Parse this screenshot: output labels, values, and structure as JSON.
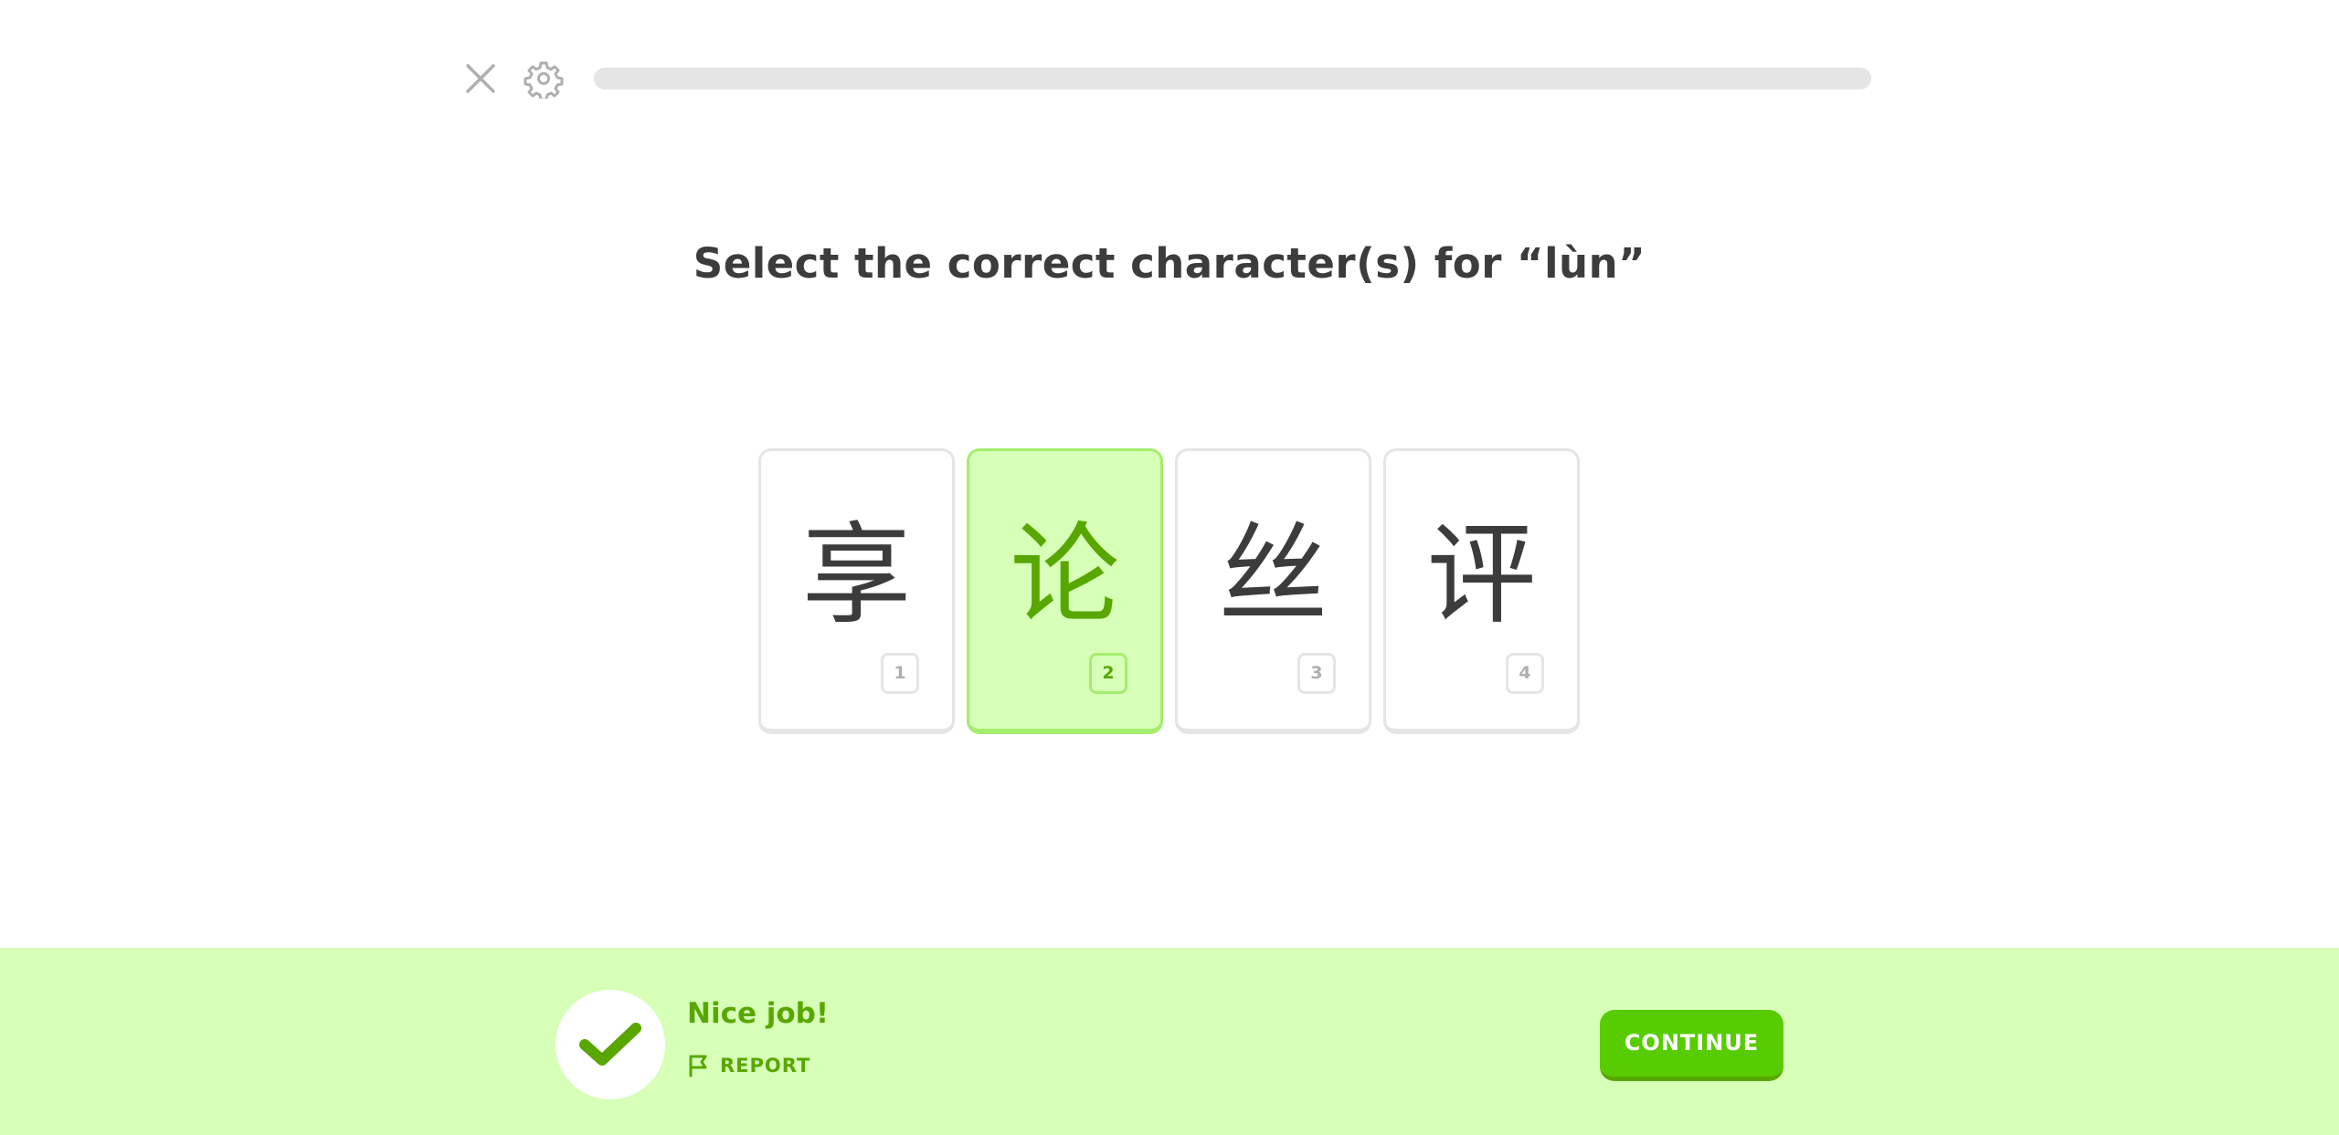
{
  "header": {
    "close_icon": "close-icon",
    "settings_icon": "gear-icon",
    "progress_percent": 0
  },
  "question": {
    "text": "Select the correct character(s) for “lùn”"
  },
  "choices": [
    {
      "glyph": "享",
      "key": "1",
      "selected": false
    },
    {
      "glyph": "论",
      "key": "2",
      "selected": true
    },
    {
      "glyph": "丝",
      "key": "3",
      "selected": false
    },
    {
      "glyph": "评",
      "key": "4",
      "selected": false
    }
  ],
  "feedback": {
    "title": "Nice job!",
    "icon": "checkmark-icon",
    "report_label": "REPORT",
    "report_icon": "flag-icon",
    "continue_label": "CONTINUE"
  },
  "colors": {
    "accent_green": "#58cc02",
    "dark_green": "#58a700",
    "light_green": "#d7ffb8",
    "selected_border": "#a5ed6e",
    "text_dark": "#3c3c3c",
    "border_gray": "#e5e5e5"
  }
}
